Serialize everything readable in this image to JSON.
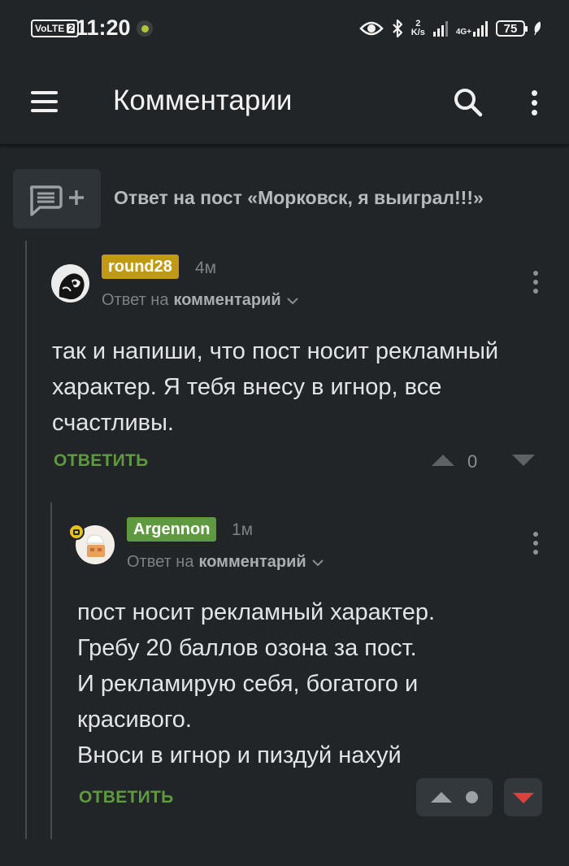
{
  "status_bar": {
    "volte": "VoLTE",
    "sim": "2",
    "time": "11:20",
    "speed_value": "2",
    "speed_unit": "K/s",
    "network": "4G+",
    "battery": "75"
  },
  "app_bar": {
    "title": "Комментарии",
    "icons": [
      "menu-icon",
      "search-icon",
      "more-vert-icon"
    ]
  },
  "post_reply": {
    "text": "Ответ на пост «Морковск, я выиграл!!!»",
    "icon": "add-comment-icon"
  },
  "comments": [
    {
      "username": "round28",
      "username_color": "#c09a14",
      "time": "4м",
      "reply_prefix": "Ответ на",
      "reply_target": "комментарий",
      "lines": [
        "так и напиши, что пост носит рекламный",
        "характер. Я тебя внесу в игнор, все",
        "счастливы."
      ],
      "answer_label": "ОТВЕТИТЬ",
      "rating": "0"
    },
    {
      "username": "Argennon",
      "username_color": "#5f9a41",
      "time": "1м",
      "reply_prefix": "Ответ на",
      "reply_target": "комментарий",
      "lines": [
        "пост носит рекламный характер.",
        "Гребу 20 баллов озона за пост.",
        "И рекламирую себя, богатого и",
        "красивого.",
        "Вноси в игнор и пиздуй нахуй"
      ],
      "answer_label": "ОТВЕТИТЬ"
    }
  ],
  "colors": {
    "background": "#212528",
    "accent_green": "#5e9a3f",
    "downvote_red": "#d9433b"
  }
}
